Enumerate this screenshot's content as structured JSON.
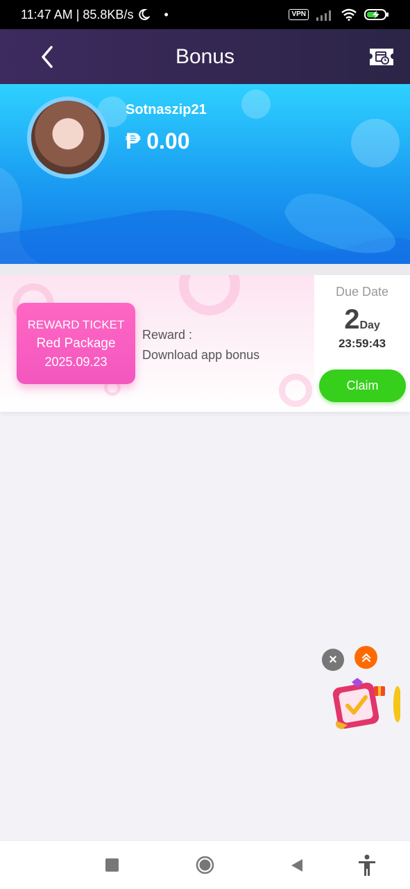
{
  "status_bar": {
    "time_speed": "11:47 AM | 85.8KB/s",
    "vpn": "VPN"
  },
  "header": {
    "title": "Bonus"
  },
  "profile": {
    "username": "Sotnaszip21",
    "balance": "₱ 0.00"
  },
  "reward": {
    "ticket_type": "REWARD TICKET",
    "ticket_name": "Red Package",
    "ticket_date": "2025.09.23",
    "label": "Reward :",
    "description": "Download app bonus",
    "due_title": "Due Date",
    "due_days": "2",
    "due_unit": "Day",
    "due_time": "23:59:43",
    "claim_label": "Claim"
  },
  "floating_widget": {
    "close_icon": "close-icon",
    "expand_icon": "double-chevron-up-icon",
    "gift_icon": "checkin-gift-icon"
  },
  "nav_bar": {
    "icons": [
      "recent-apps-icon",
      "home-icon",
      "back-icon",
      "accessibility-icon"
    ]
  },
  "colors": {
    "header_bg": "#3d2a5f",
    "banner_top": "#2ed1ff",
    "banner_bottom": "#1177e6",
    "ticket_pink": "#ff67c3",
    "claim_green": "#36cf1b",
    "float_orange": "#ff6a00"
  }
}
